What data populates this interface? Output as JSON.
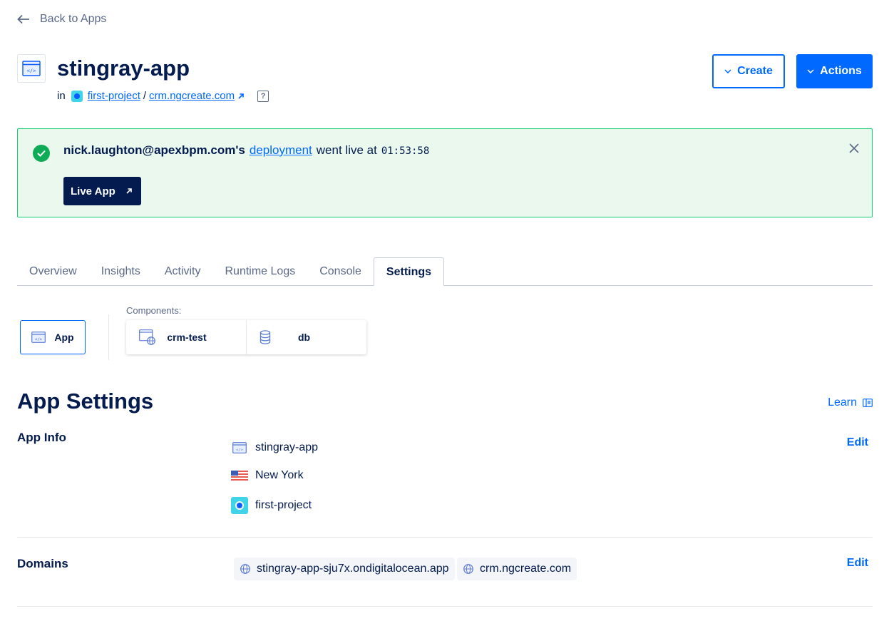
{
  "nav": {
    "back_label": "Back to Apps"
  },
  "app": {
    "title": "stingray-app",
    "in_label": "in",
    "project": "first-project",
    "separator": "/",
    "domain": "crm.ngcreate.com",
    "help": "?"
  },
  "header_buttons": {
    "create": "Create",
    "actions": "Actions"
  },
  "banner": {
    "user": "nick.laughton@apexbpm.com's",
    "link": "deployment",
    "text": "went live at",
    "time": "01:53:58",
    "live_button": "Live App"
  },
  "tabs": [
    {
      "label": "Overview"
    },
    {
      "label": "Insights"
    },
    {
      "label": "Activity"
    },
    {
      "label": "Runtime Logs"
    },
    {
      "label": "Console"
    },
    {
      "label": "Settings",
      "active": true
    }
  ],
  "components": {
    "app_label": "App",
    "label": "Components:",
    "items": [
      {
        "name": "crm-test",
        "icon": "web-service-icon"
      },
      {
        "name": "db",
        "icon": "database-icon"
      }
    ]
  },
  "settings": {
    "title": "App Settings",
    "learn": "Learn",
    "app_info": {
      "label": "App Info",
      "edit": "Edit",
      "name": "stingray-app",
      "region": "New York",
      "project": "first-project"
    },
    "domains": {
      "label": "Domains",
      "edit": "Edit",
      "list": [
        "stingray-app-sju7x.ondigitalocean.app",
        "crm.ngcreate.com"
      ]
    }
  },
  "colors": {
    "accent": "#0069ff",
    "navy": "#031b4e",
    "success": "#0fab57",
    "success_bg": "#eaf8ee"
  }
}
